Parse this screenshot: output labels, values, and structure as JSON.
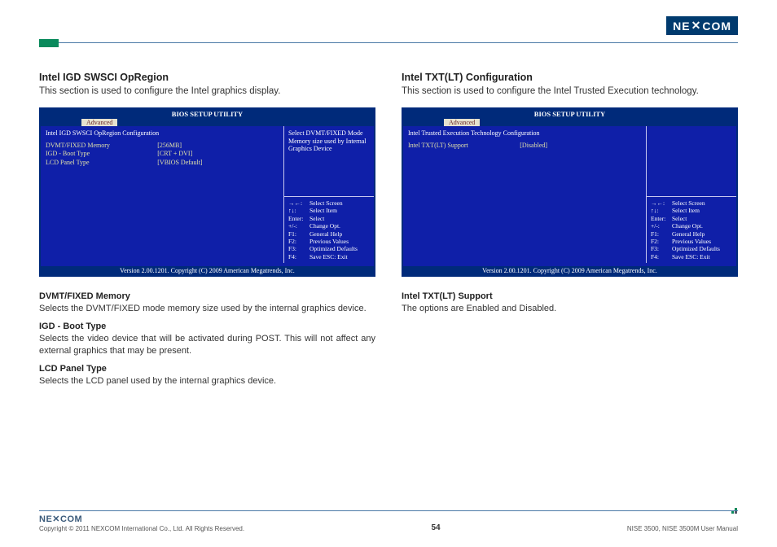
{
  "brand": "NEXCOM",
  "page_number": "54",
  "copyright": "Copyright © 2011 NEXCOM International Co., Ltd. All Rights Reserved.",
  "manual_name": "NISE 3500, NISE 3500M User Manual",
  "left": {
    "heading": "Intel IGD SWSCI OpRegion",
    "desc": "This section is used to configure the Intel graphics display.",
    "bios": {
      "title": "BIOS SETUP UTILITY",
      "tab": "Advanced",
      "config_title": "Intel IGD SWSCI OpRegion Configuration",
      "rows": [
        {
          "label": "DVMT/FIXED Memory",
          "val": "[256MB]"
        },
        {
          "label": "IGD - Boot Type",
          "val": "[CRT + DVI]"
        },
        {
          "label": "LCD Panel Type",
          "val": "[VBIOS Default]"
        }
      ],
      "help": "Select DVMT/FIXED Mode Memory size used by Internal Graphics Device",
      "keys": [
        {
          "k": "→←:",
          "v": "Select Screen"
        },
        {
          "k": "↑↓:",
          "v": "Select Item"
        },
        {
          "k": "Enter:",
          "v": "Select"
        },
        {
          "k": "+/-:",
          "v": "Change Opt."
        },
        {
          "k": "F1:",
          "v": "General Help"
        },
        {
          "k": "F2:",
          "v": "Previous Values"
        },
        {
          "k": "F3:",
          "v": "Optimized Defaults"
        },
        {
          "k": "F4:",
          "v": "Save   ESC: Exit"
        }
      ],
      "version": "Version 2.00.1201. Copyright (C) 2009 American Megatrends, Inc."
    },
    "subs": [
      {
        "h": "DVMT/FIXED Memory",
        "d": "Selects the DVMT/FIXED mode memory size used by the internal graphics device."
      },
      {
        "h": "IGD - Boot Type",
        "d": "Selects the video device that will be activated during POST. This will not affect any external graphics that may be present."
      },
      {
        "h": "LCD Panel Type",
        "d": "Selects the LCD panel used by the internal graphics device."
      }
    ]
  },
  "right": {
    "heading": "Intel TXT(LT) Configuration",
    "desc": "This section is used to configure the Intel Trusted Execution technology.",
    "bios": {
      "title": "BIOS SETUP UTILITY",
      "tab": "Advanced",
      "config_title": "Intel Trusted Execution Technology Configuration",
      "rows": [
        {
          "label": "Intel TXT(LT) Support",
          "val": "[Disabled]"
        }
      ],
      "help": "",
      "keys": [
        {
          "k": "→←:",
          "v": "Select Screen"
        },
        {
          "k": "↑↓:",
          "v": "Select Item"
        },
        {
          "k": "Enter:",
          "v": "Select"
        },
        {
          "k": "+/-:",
          "v": "Change Opt."
        },
        {
          "k": "F1:",
          "v": "General Help"
        },
        {
          "k": "F2:",
          "v": "Previous Values"
        },
        {
          "k": "F3:",
          "v": "Optimized Defaults"
        },
        {
          "k": "F4:",
          "v": "Save   ESC: Exit"
        }
      ],
      "version": "Version 2.00.1201. Copyright (C) 2009 American Megatrends, Inc."
    },
    "subs": [
      {
        "h": "Intel TXT(LT) Support",
        "d": "The options are Enabled and Disabled."
      }
    ]
  }
}
